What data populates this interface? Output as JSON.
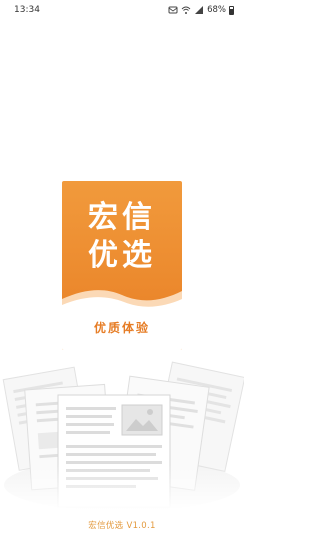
{
  "status_bar": {
    "time": "13:34",
    "battery": "68%",
    "icons": [
      "notification-icon",
      "wifi-icon",
      "signal-icon",
      "battery-icon"
    ]
  },
  "logo": {
    "line1": "宏信",
    "line2": "优选",
    "slogan": "优质体验"
  },
  "footer": {
    "version": "宏信优选 V1.0.1"
  },
  "colors": {
    "brand_orange": "#ec8a2e",
    "version_text": "#e39a3e"
  }
}
